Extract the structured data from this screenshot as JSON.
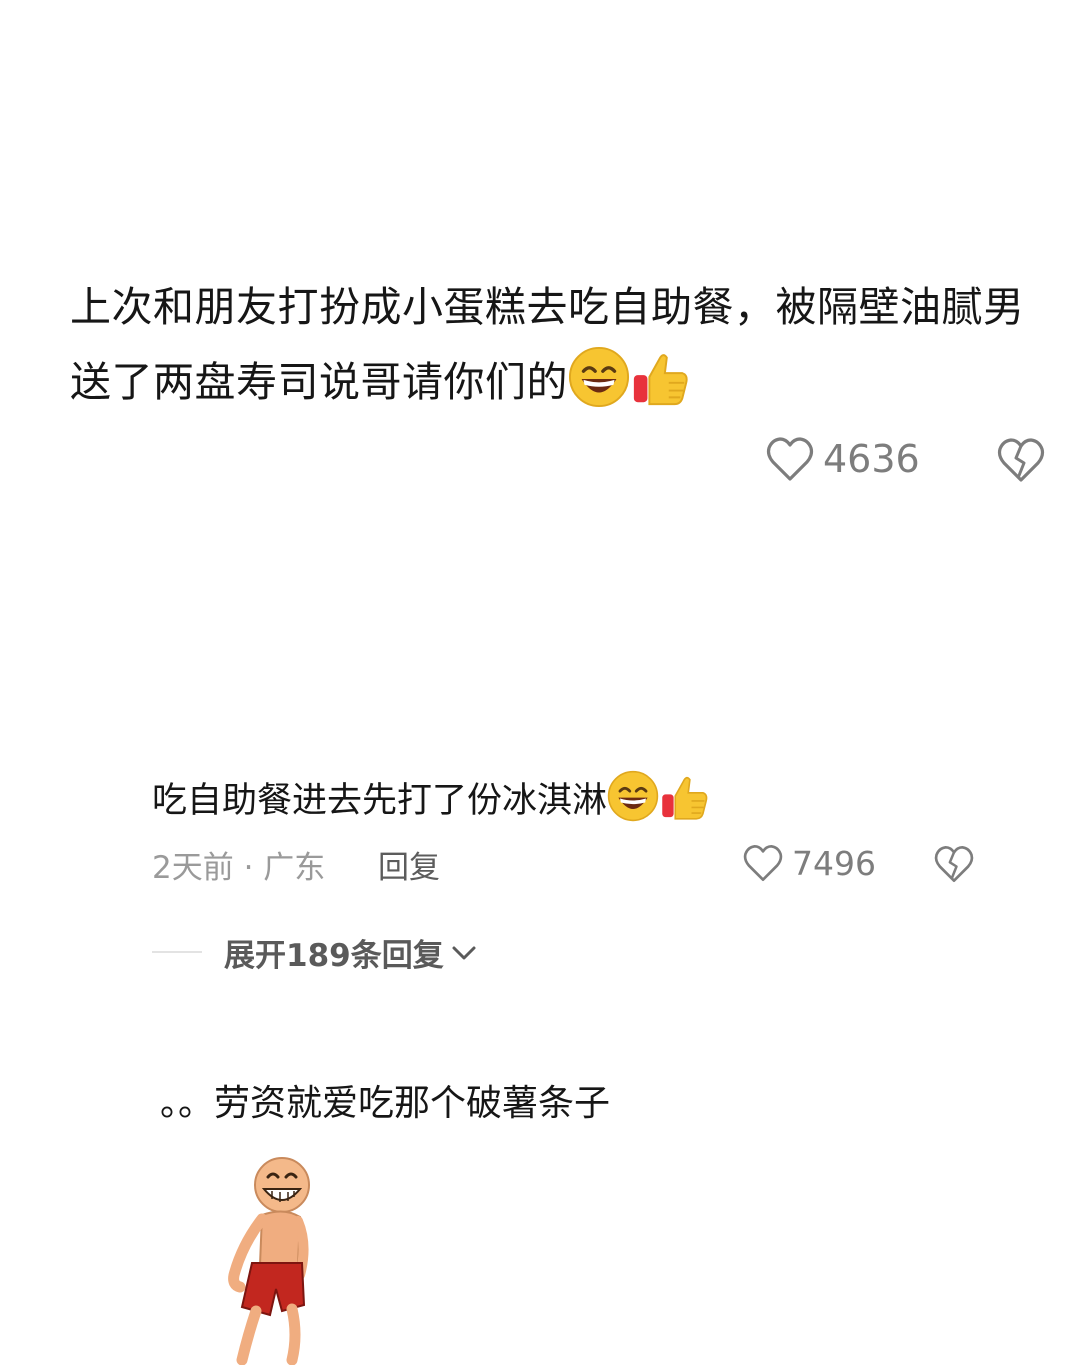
{
  "comment1": {
    "text": "上次和朋友打扮成小蛋糕去吃自助餐，被隔壁油腻男送了两盘寿司说哥请你们的",
    "emojis": [
      "grinning-face",
      "thumbs-up"
    ],
    "likes": "4636"
  },
  "comment2": {
    "text": "吃自助餐进去先打了份冰淇淋",
    "emojis": [
      "grinning-face",
      "thumbs-up"
    ],
    "meta": "2天前 · 广东",
    "reply_label": "回复",
    "likes": "7496",
    "expand_label": "展开189条回复"
  },
  "comment3": {
    "text": "。。劳资就爱吃那个破薯条子",
    "sticker": "dancing-man-sticker"
  },
  "colors": {
    "text": "#161616",
    "meta": "#9a9a9a",
    "icon": "#7d7d7d",
    "background": "#ffffff"
  }
}
